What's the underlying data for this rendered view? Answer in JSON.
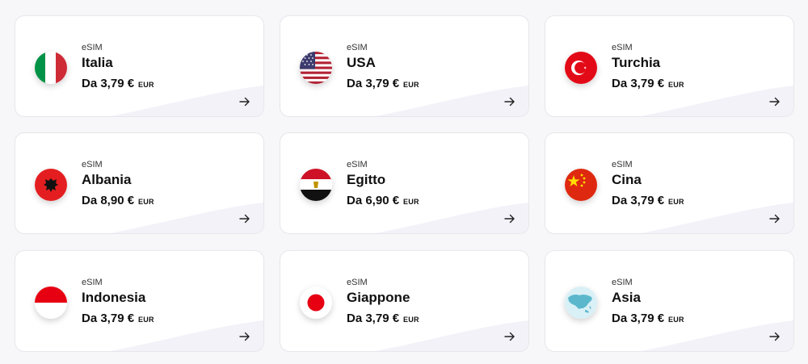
{
  "cards": [
    {
      "label": "eSIM",
      "name": "Italia",
      "price": "Da 3,79 €",
      "currency": "EUR",
      "flag": "italy-flag"
    },
    {
      "label": "eSIM",
      "name": "USA",
      "price": "Da 3,79 €",
      "currency": "EUR",
      "flag": "usa-flag"
    },
    {
      "label": "eSIM",
      "name": "Turchia",
      "price": "Da 3,79 €",
      "currency": "EUR",
      "flag": "turkey-flag"
    },
    {
      "label": "eSIM",
      "name": "Albania",
      "price": "Da 8,90 €",
      "currency": "EUR",
      "flag": "albania-flag"
    },
    {
      "label": "eSIM",
      "name": "Egitto",
      "price": "Da 6,90 €",
      "currency": "EUR",
      "flag": "egypt-flag"
    },
    {
      "label": "eSIM",
      "name": "Cina",
      "price": "Da 3,79 €",
      "currency": "EUR",
      "flag": "china-flag"
    },
    {
      "label": "eSIM",
      "name": "Indonesia",
      "price": "Da 3,79 €",
      "currency": "EUR",
      "flag": "indonesia-flag"
    },
    {
      "label": "eSIM",
      "name": "Giappone",
      "price": "Da 3,79 €",
      "currency": "EUR",
      "flag": "japan-flag"
    },
    {
      "label": "eSIM",
      "name": "Asia",
      "price": "Da 3,79 €",
      "currency": "EUR",
      "flag": "asia-map"
    }
  ],
  "colors": {
    "card_bg": "#ffffff",
    "card_border": "#e6e6ec",
    "page_bg": "#f7f7f9"
  }
}
